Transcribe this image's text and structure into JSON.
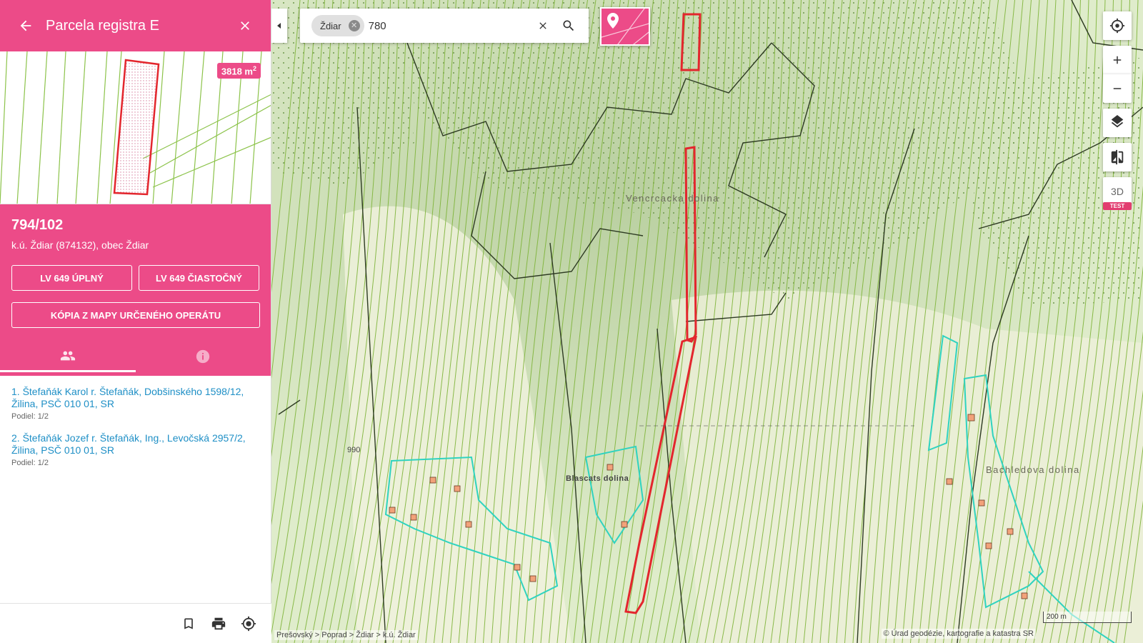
{
  "panel": {
    "title": "Parcela registra E",
    "area_value": "3818 m",
    "area_unit_exp": "2",
    "parcel_number": "794/102",
    "location": "k.ú. Ždiar (874132), obec Ždiar",
    "buttons": {
      "lv_full": "LV 649 ÚPLNÝ",
      "lv_partial": "LV 649 ČIASTOČNÝ",
      "map_copy": "KÓPIA Z MAPY URČENÉHO OPERÁTU"
    },
    "owners": [
      {
        "name": "1. Štefaňák Karol r. Štefaňák, Dobšinského 1598/12, Žilina, PSČ 010 01, SR",
        "share": "Podiel: 1/2"
      },
      {
        "name": "2. Štefaňák Jozef r. Štefaňák, Ing., Levočská 2957/2, Žilina, PSČ 010 01, SR",
        "share": "Podiel: 1/2"
      }
    ]
  },
  "search": {
    "chip": "Ždiar",
    "query": "780"
  },
  "map": {
    "btn_3d": "3D",
    "test_badge": "TEST",
    "labels": {
      "valley_1": "Vencrcacka dolina",
      "valley_2": "Blascats dolina",
      "valley_3": "Bachledova dolina",
      "elevation": "990"
    },
    "breadcrumb": "Prešovský > Poprad > Ždiar > k.ú. Ždiar",
    "attribution": "© Úrad geodézie, kartografie a katastra SR",
    "scale": "200 m"
  },
  "colors": {
    "accent": "#ec4b88",
    "parcel_highlight": "#e3262d",
    "parcel_lines": "#7fb43a",
    "built_area": "#2fd3c0"
  },
  "icons": [
    "back-arrow-icon",
    "close-icon",
    "people-icon",
    "info-icon",
    "bookmark-icon",
    "print-icon",
    "locate-icon",
    "search-icon",
    "gps-icon",
    "plus-icon",
    "minus-icon",
    "layers-icon",
    "compare-icon",
    "chevron-left-icon"
  ]
}
